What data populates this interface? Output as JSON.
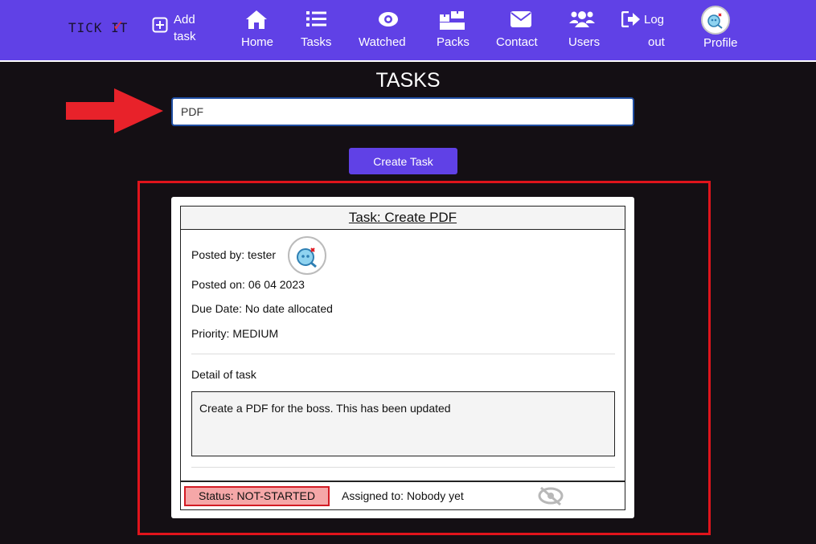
{
  "brand": {
    "text": "TICK IT",
    "check": "✓"
  },
  "nav": {
    "add_task_line1": "Add",
    "add_task_line2": "task",
    "home": "Home",
    "tasks": "Tasks",
    "watched": "Watched",
    "packs": "Packs",
    "contact": "Contact",
    "users": "Users",
    "logout_line1": "Log",
    "logout_line2": "out",
    "profile": "Profile"
  },
  "page": {
    "title": "TASKS",
    "search_value": "PDF",
    "create_button": "Create Task"
  },
  "task": {
    "title": "Task: Create PDF",
    "posted_by": "Posted by: tester",
    "posted_on": "Posted on: 06 04 2023",
    "due_date": "Due Date: No date allocated",
    "priority": "Priority: MEDIUM",
    "detail_label": "Detail of task",
    "detail_text": "Create a PDF for the boss. This has been updated",
    "status": "Status: NOT-STARTED",
    "assigned": "Assigned to: Nobody yet"
  },
  "colors": {
    "navbar": "#6041e6",
    "background": "#140f14",
    "highlight": "#e0141c",
    "status_bg": "#f5a7a8"
  },
  "icons": [
    "add-task-icon",
    "home-icon",
    "tasks-list-icon",
    "watched-eye-icon",
    "packs-icon",
    "contact-envelope-icon",
    "users-icon",
    "logout-icon",
    "profile-avatar-icon",
    "eye-slash-icon"
  ]
}
